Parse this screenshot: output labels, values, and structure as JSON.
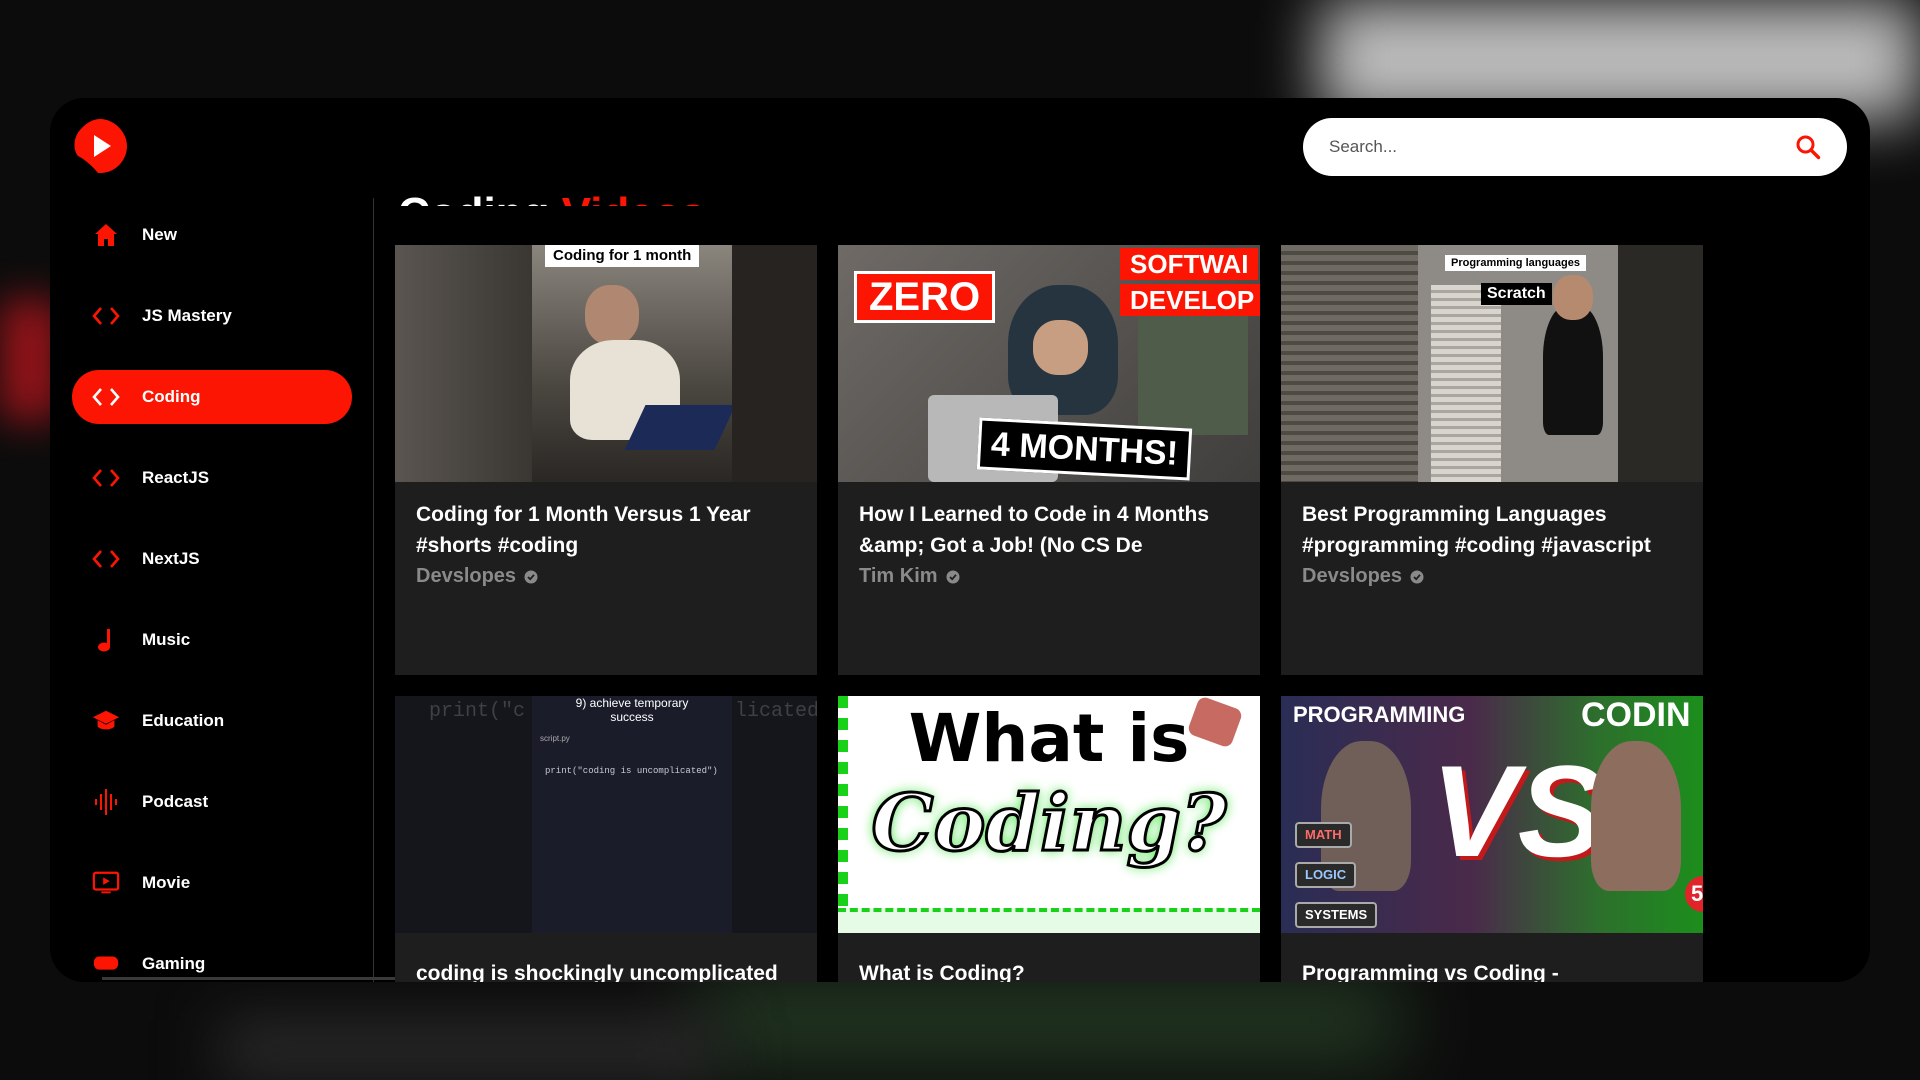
{
  "search": {
    "placeholder": "Search..."
  },
  "page_title": {
    "main": "Coding",
    "accent": "Videos"
  },
  "sidebar": {
    "items": [
      {
        "label": "New",
        "icon": "home-icon",
        "active": false
      },
      {
        "label": "JS Mastery",
        "icon": "code-icon",
        "active": false
      },
      {
        "label": "Coding",
        "icon": "code-icon",
        "active": true
      },
      {
        "label": "ReactJS",
        "icon": "code-icon",
        "active": false
      },
      {
        "label": "NextJS",
        "icon": "code-icon",
        "active": false
      },
      {
        "label": "Music",
        "icon": "music-note-icon",
        "active": false
      },
      {
        "label": "Education",
        "icon": "graduation-cap-icon",
        "active": false
      },
      {
        "label": "Podcast",
        "icon": "soundwave-icon",
        "active": false
      },
      {
        "label": "Movie",
        "icon": "video-icon",
        "active": false
      },
      {
        "label": "Gaming",
        "icon": "gamepad-icon",
        "active": false
      }
    ]
  },
  "videos": [
    {
      "title": "Coding for 1 Month Versus 1 Year #shorts #coding",
      "channel": "Devslopes",
      "thumb_text": "Coding for 1 month"
    },
    {
      "title": "How I Learned to Code in 4 Months &amp; Got a Job! (No CS De",
      "channel": "Tim Kim",
      "thumb_text": [
        "ZERO",
        "SOFTWAI",
        "DEVELOP",
        "4 MONTHS!"
      ]
    },
    {
      "title": "Best Programming Languages #programming #coding #javascript",
      "channel": "Devslopes",
      "thumb_text": [
        "Programming languages",
        "Scratch"
      ]
    },
    {
      "title": "coding is shockingly uncomplicated",
      "channel": "",
      "thumb_text": [
        "9) achieve temporary",
        "success",
        "print(\"c",
        "licated",
        "script.py",
        "print(\"coding is uncomplicated\")"
      ]
    },
    {
      "title": "What is Coding?",
      "channel": "",
      "thumb_text": [
        "What is",
        "Coding?"
      ]
    },
    {
      "title": "Programming vs Coding -",
      "channel": "",
      "thumb_text": [
        "PROGRAMMING",
        "CODIN",
        "VS",
        "MATH",
        "LOGIC",
        "SYSTEMS",
        "5"
      ]
    }
  ],
  "colors": {
    "accent": "#fc1503",
    "card_bg": "#1e1e1e",
    "app_bg": "#000000"
  }
}
